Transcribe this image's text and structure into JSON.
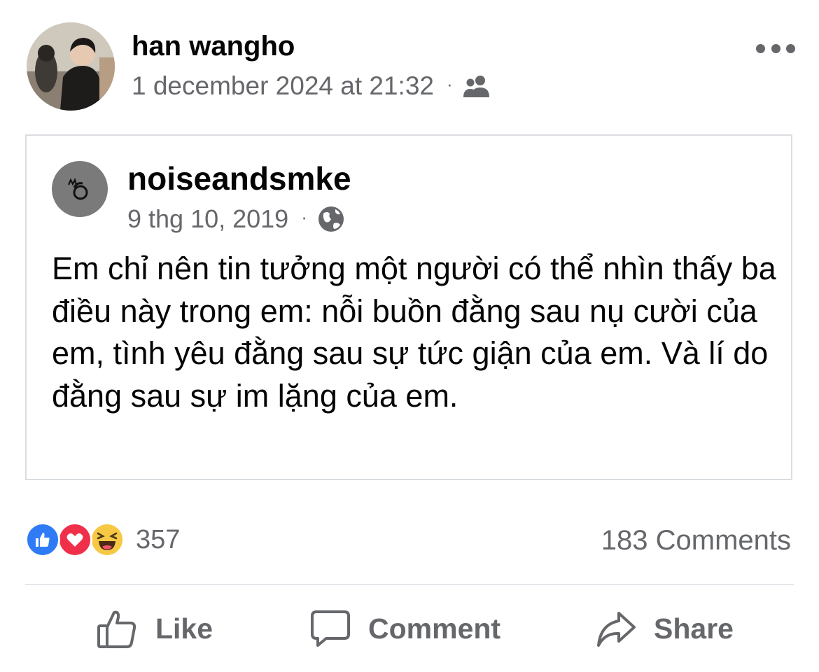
{
  "post": {
    "author": "han wangho",
    "timestamp": "1 december 2024 at 21:32",
    "separator": "·",
    "audience_icon": "friends-icon"
  },
  "shared_post": {
    "author": "noiseandsmke",
    "date": "9 thg 10, 2019",
    "separator": "·",
    "audience_icon": "globe-icon",
    "text": "Em chỉ nên tin tưởng một người có thể nhìn thấy ba điều này trong em: nỗi buồn đằng sau nụ cười của em, tình yêu đằng sau sự tức giận của em. Và lí do đằng sau sự im lặng của em."
  },
  "engagement": {
    "reaction_icons": [
      "like-reaction-icon",
      "love-reaction-icon",
      "haha-reaction-icon"
    ],
    "reaction_count": "357",
    "comments": "183 Comments"
  },
  "actions": {
    "like": "Like",
    "comment": "Comment",
    "share": "Share"
  },
  "colors": {
    "text_primary": "#050505",
    "text_secondary": "#65676b",
    "like_blue": "#2f7bf6",
    "love_red": "#f0304b",
    "haha_yellow": "#f7c843",
    "divider": "#e4e6eb"
  }
}
